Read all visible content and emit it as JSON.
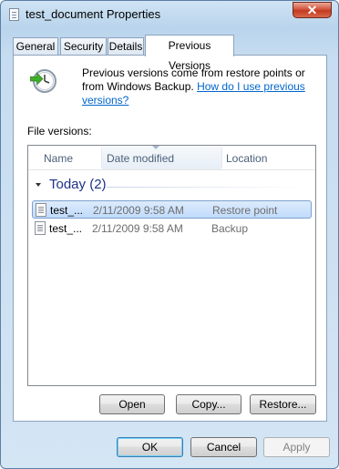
{
  "window": {
    "title": "test_document Properties",
    "close_label": "✕"
  },
  "tabs": [
    {
      "label": "General"
    },
    {
      "label": "Security"
    },
    {
      "label": "Details"
    },
    {
      "label": "Previous Versions"
    }
  ],
  "info": {
    "text": "Previous versions come from restore points or from Windows Backup.",
    "link": "How do I use previous versions?"
  },
  "file_versions_label": "File versions:",
  "columns": {
    "name": "Name",
    "date": "Date modified",
    "location": "Location"
  },
  "group": {
    "label": "Today (2)"
  },
  "rows": [
    {
      "name": "test_...",
      "date": "2/11/2009 9:58 AM",
      "location": "Restore point",
      "selected": true
    },
    {
      "name": "test_...",
      "date": "2/11/2009 9:58 AM",
      "location": "Backup",
      "selected": false
    }
  ],
  "actions": {
    "open": "Open",
    "copy": "Copy...",
    "restore": "Restore..."
  },
  "dialog": {
    "ok": "OK",
    "cancel": "Cancel",
    "apply": "Apply"
  },
  "colors": {
    "link": "#0066cc",
    "group_header": "#1e3287",
    "selection": "#c1dbfc"
  },
  "icons": {
    "clock": "restore-clock-icon",
    "document": "document-icon",
    "close": "close-icon"
  }
}
